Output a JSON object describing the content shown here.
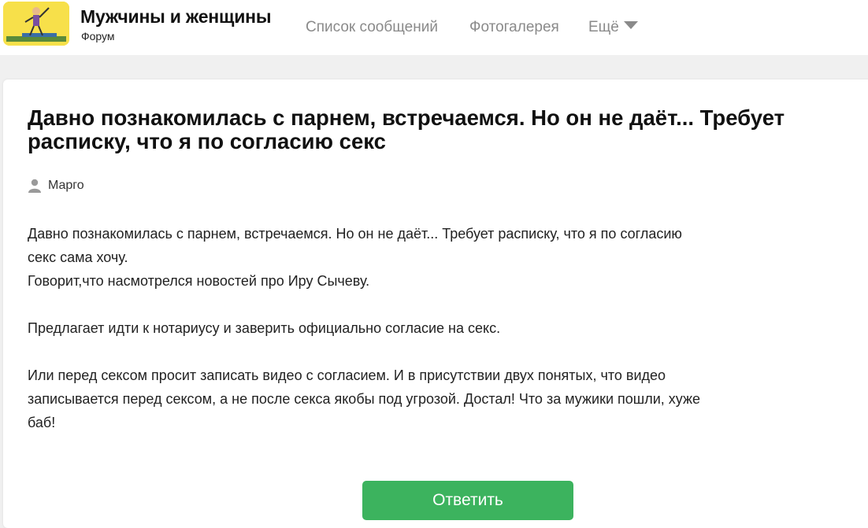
{
  "header": {
    "site_title": "Мужчины и женщины",
    "site_subtitle": "Форум",
    "nav": {
      "messages": "Список сообщений",
      "gallery": "Фотогалерея",
      "more": "Ещё"
    }
  },
  "post": {
    "title": "Давно познакомилась с парнем, встречаемся. Но он не даёт... Требует расписку, что я по согласию секс",
    "author": "Марго",
    "body": {
      "line1": "Давно познакомилась с парнем, встречаемся. Но он не даёт... Требует расписку, что я по согласию секс сама хочу.",
      "line2": "Говорит,что насмотрелся новостей про Иру Сычеву.",
      "line3": "Предлагает идти к нотариусу и заверить официально согласие на секс.",
      "line4": "Или перед сексом просит записать видео с согласием. И в присутствии двух понятых, что видео записывается перед сексом, а не после секса якобы под угрозой. Достал! Что за мужики пошли, хуже баб!"
    }
  },
  "actions": {
    "reply_label": "Ответить"
  },
  "colors": {
    "accent_green": "#3cb35e",
    "logo_yellow": "#f7e04a",
    "nav_gray": "#8a8a8a"
  }
}
